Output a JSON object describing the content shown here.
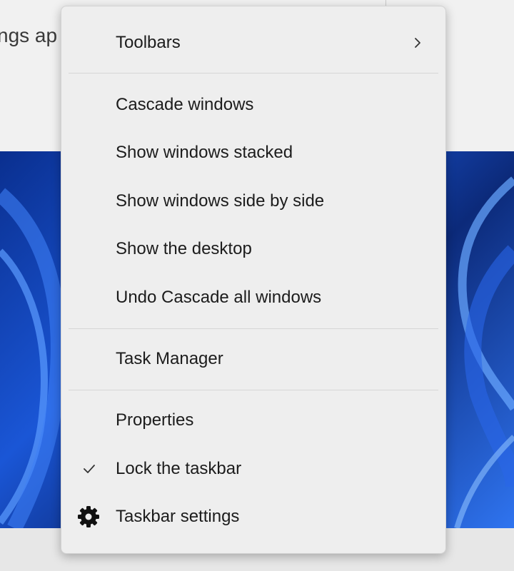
{
  "background": {
    "window_text": "ngs ap",
    "wallpaper_color": "#1a56d6"
  },
  "menu": {
    "items": [
      {
        "id": "toolbars",
        "label": "Toolbars",
        "icon": "chevron-right-icon"
      },
      {
        "id": "cascade",
        "label": "Cascade windows"
      },
      {
        "id": "stacked",
        "label": "Show windows stacked"
      },
      {
        "id": "side-by-side",
        "label": "Show windows side by side"
      },
      {
        "id": "desktop",
        "label": "Show the desktop"
      },
      {
        "id": "undo-cascade",
        "label": "Undo Cascade all windows"
      },
      {
        "id": "task-manager",
        "label": "Task Manager"
      },
      {
        "id": "properties",
        "label": "Properties"
      },
      {
        "id": "lock-taskbar",
        "label": "Lock the taskbar",
        "icon": "checkmark-icon",
        "checked": true
      },
      {
        "id": "taskbar-settings",
        "label": "Taskbar settings",
        "icon": "gear-icon"
      }
    ]
  }
}
